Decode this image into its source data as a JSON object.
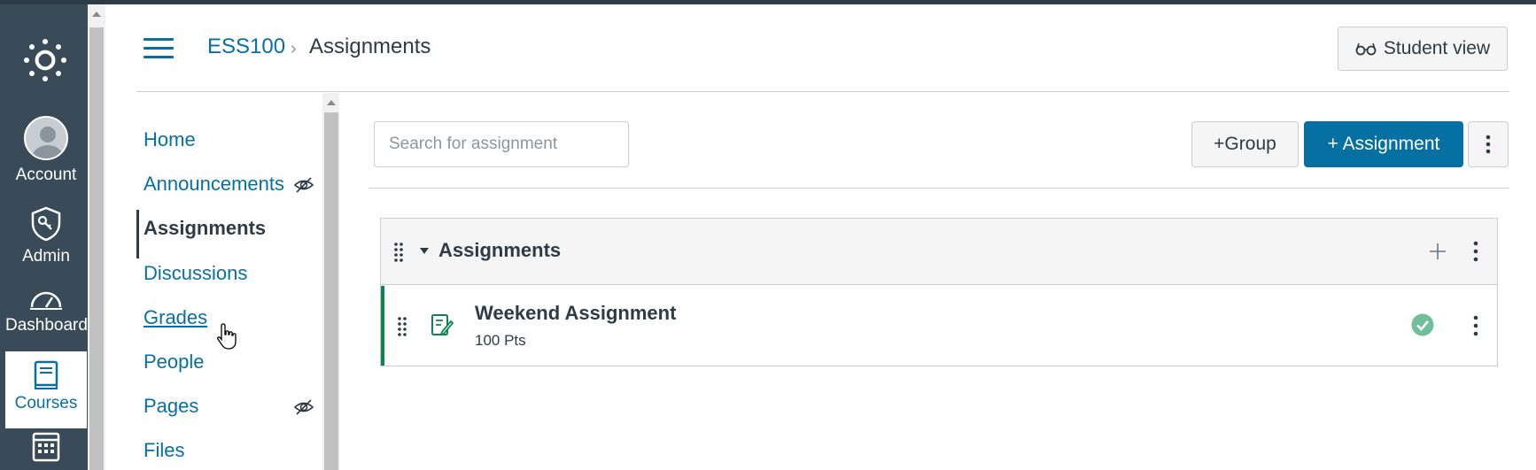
{
  "global_nav": {
    "account_label": "Account",
    "admin_label": "Admin",
    "dashboard_label": "Dashboard",
    "courses_label": "Courses",
    "active_color": "#0770a3",
    "bg_color": "#394b58"
  },
  "header": {
    "breadcrumb_course": "ESS100",
    "breadcrumb_separator": "›",
    "breadcrumb_current": "Assignments",
    "student_view_label": "Student view"
  },
  "course_nav": {
    "items": [
      {
        "label": "Home",
        "hidden": false
      },
      {
        "label": "Announcements",
        "hidden": true
      },
      {
        "label": "Assignments",
        "hidden": false,
        "active": true
      },
      {
        "label": "Discussions",
        "hidden": false
      },
      {
        "label": "Grades",
        "hidden": false
      },
      {
        "label": "People",
        "hidden": false
      },
      {
        "label": "Pages",
        "hidden": true
      },
      {
        "label": "Files",
        "hidden": false
      }
    ]
  },
  "toolbar": {
    "search_placeholder": "Search for assignment",
    "add_group_label": "+Group",
    "add_assignment_label": "+ Assignment"
  },
  "assignment_group": {
    "title": "Assignments",
    "assignments": [
      {
        "title": "Weekend Assignment",
        "points": "100 Pts",
        "published": true
      }
    ]
  },
  "colors": {
    "brand_blue": "#0770a3",
    "published_green": "#0b874b",
    "published_check": "#6fbf9b"
  }
}
